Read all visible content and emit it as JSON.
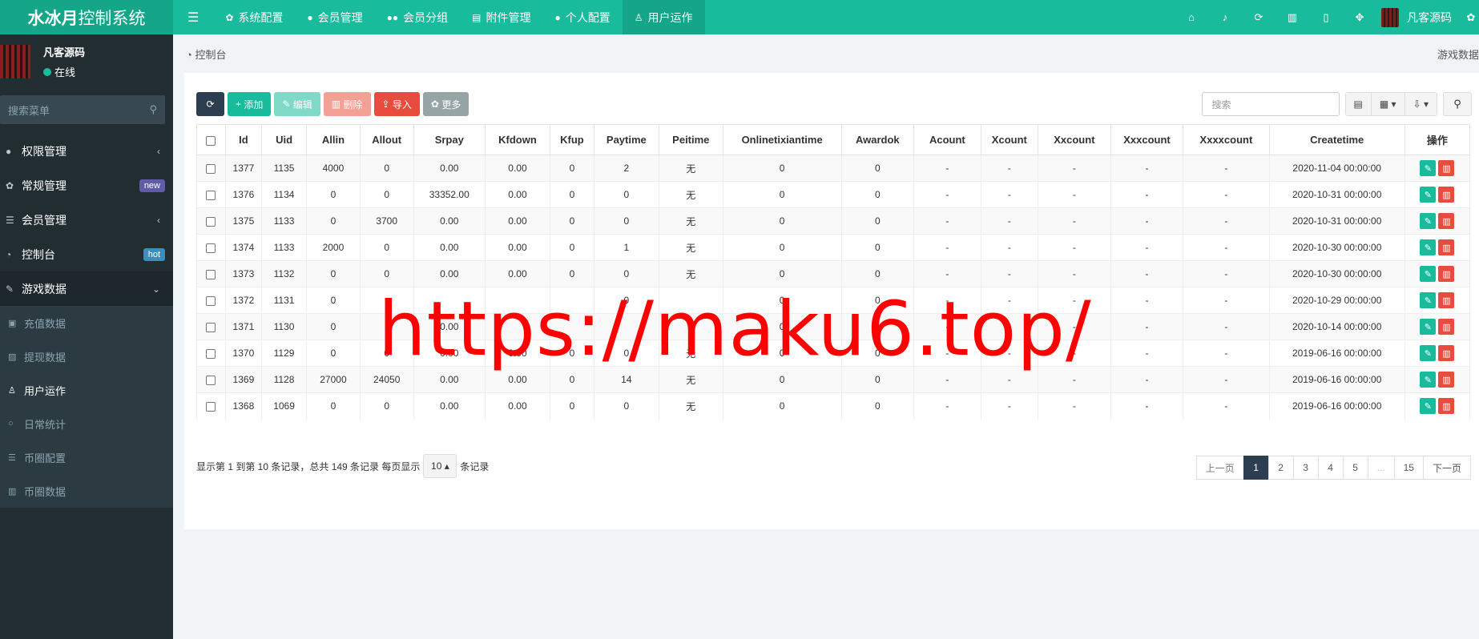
{
  "header": {
    "logo_bold": "水冰月",
    "logo_rest": "控制系统",
    "nav": [
      {
        "label": "系统配置",
        "icon": "gear-icon"
      },
      {
        "label": "会员管理",
        "icon": "user-icon"
      },
      {
        "label": "会员分组",
        "icon": "users-icon"
      },
      {
        "label": "附件管理",
        "icon": "file-icon"
      },
      {
        "label": "个人配置",
        "icon": "user-icon"
      },
      {
        "label": "用户运作",
        "icon": "user-outline-icon"
      }
    ],
    "username": "凡客源码"
  },
  "sidebar": {
    "user": {
      "name": "凡客源码",
      "status": "在线"
    },
    "search_placeholder": "搜索菜单",
    "items": [
      {
        "label": "权限管理",
        "icon": "users-icon"
      },
      {
        "label": "常规管理",
        "icon": "cogs-icon",
        "badge": "new"
      },
      {
        "label": "会员管理",
        "icon": "list-icon"
      },
      {
        "label": "控制台",
        "icon": "dashboard-icon",
        "badge": "hot"
      },
      {
        "label": "游戏数据",
        "icon": "magic-icon"
      }
    ],
    "subitems": [
      {
        "label": "充值数据",
        "icon": "money-icon"
      },
      {
        "label": "提现数据",
        "icon": "wallet-icon"
      },
      {
        "label": "用户运作",
        "icon": "user-outline-icon"
      },
      {
        "label": "日常统计",
        "icon": "circle-icon"
      },
      {
        "label": "币圈配置",
        "icon": "list-icon"
      },
      {
        "label": "币圈数据",
        "icon": "bar-chart-icon"
      }
    ]
  },
  "breadcrumb": {
    "label": "控制台",
    "right": "游戏数据"
  },
  "toolbar": {
    "add": "添加",
    "edit": "编辑",
    "delete": "删除",
    "import": "导入",
    "more": "更多",
    "search_placeholder": "搜索"
  },
  "table": {
    "columns": [
      "Id",
      "Uid",
      "Allin",
      "Allout",
      "Srpay",
      "Kfdown",
      "Kfup",
      "Paytime",
      "Peitime",
      "Onlinetixiantime",
      "Awardok",
      "Acount",
      "Xcount",
      "Xxcount",
      "Xxxcount",
      "Xxxxcount",
      "Createtime",
      "操作"
    ],
    "rows": [
      [
        "1377",
        "1135",
        "4000",
        "0",
        "0.00",
        "0.00",
        "0",
        "2",
        "无",
        "0",
        "0",
        "-",
        "-",
        "-",
        "-",
        "-",
        "2020-11-04 00:00:00"
      ],
      [
        "1376",
        "1134",
        "0",
        "0",
        "33352.00",
        "0.00",
        "0",
        "0",
        "无",
        "0",
        "0",
        "-",
        "-",
        "-",
        "-",
        "-",
        "2020-10-31 00:00:00"
      ],
      [
        "1375",
        "1133",
        "0",
        "3700",
        "0.00",
        "0.00",
        "0",
        "0",
        "无",
        "0",
        "0",
        "-",
        "-",
        "-",
        "-",
        "-",
        "2020-10-31 00:00:00"
      ],
      [
        "1374",
        "1133",
        "2000",
        "0",
        "0.00",
        "0.00",
        "0",
        "1",
        "无",
        "0",
        "0",
        "-",
        "-",
        "-",
        "-",
        "-",
        "2020-10-30 00:00:00"
      ],
      [
        "1373",
        "1132",
        "0",
        "0",
        "0.00",
        "0.00",
        "0",
        "0",
        "无",
        "0",
        "0",
        "-",
        "-",
        "-",
        "-",
        "-",
        "2020-10-30 00:00:00"
      ],
      [
        "1372",
        "1131",
        "0",
        "",
        "",
        "",
        "",
        "0",
        "",
        "0",
        "0",
        "-",
        "-",
        "-",
        "-",
        "-",
        "2020-10-29 00:00:00"
      ],
      [
        "1371",
        "1130",
        "0",
        "",
        "0.00",
        "",
        "",
        "",
        "",
        "0",
        "",
        "-",
        "-",
        "-",
        "-",
        "-",
        "2020-10-14 00:00:00"
      ],
      [
        "1370",
        "1129",
        "0",
        "0",
        "0.00",
        "0.00",
        "0",
        "0",
        "无",
        "0",
        "0",
        "-",
        "-",
        "-",
        "-",
        "-",
        "2019-06-16 00:00:00"
      ],
      [
        "1369",
        "1128",
        "27000",
        "24050",
        "0.00",
        "0.00",
        "0",
        "14",
        "无",
        "0",
        "0",
        "-",
        "-",
        "-",
        "-",
        "-",
        "2019-06-16 00:00:00"
      ],
      [
        "1368",
        "1069",
        "0",
        "0",
        "0.00",
        "0.00",
        "0",
        "0",
        "无",
        "0",
        "0",
        "-",
        "-",
        "-",
        "-",
        "-",
        "2019-06-16 00:00:00"
      ]
    ]
  },
  "footer": {
    "info": "显示第 1 到第 10 条记录，总共 149 条记录 每页显示",
    "page_size": "10",
    "suffix": "条记录"
  },
  "pagination": {
    "prev": "上一页",
    "pages": [
      "1",
      "2",
      "3",
      "4",
      "5",
      "...",
      "15"
    ],
    "next": "下一页",
    "current": "1"
  },
  "watermark": "https://maku6.top/"
}
